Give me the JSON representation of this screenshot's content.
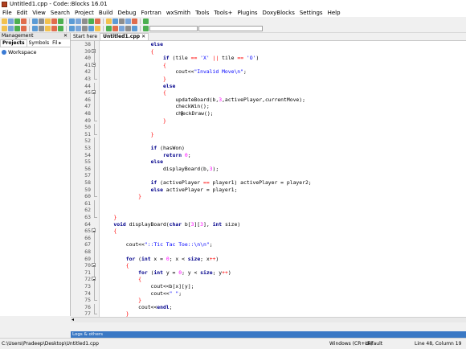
{
  "window": {
    "title": "Untitled1.cpp - Code::Blocks 16.01"
  },
  "menu": [
    "File",
    "Edit",
    "View",
    "Search",
    "Project",
    "Build",
    "Debug",
    "Fortran",
    "wxSmith",
    "Tools",
    "Tools+",
    "Plugins",
    "DoxyBlocks",
    "Settings",
    "Help"
  ],
  "management": {
    "title": "Management",
    "close": "✕",
    "tabs": [
      "Projects",
      "Symbols",
      "Fil ▸"
    ],
    "workspace": "Workspace"
  },
  "editor_tabs": {
    "start_here": "Start here",
    "file": "Untitled1.cpp",
    "file_close": "✕"
  },
  "code_lines": [
    {
      "n": "38",
      "fold": "bar",
      "t": [
        [
          "",
          "                "
        ],
        [
          "kw",
          "else"
        ]
      ]
    },
    {
      "n": "39",
      "fold": "box",
      "t": [
        [
          "",
          "                "
        ],
        [
          "br",
          "{"
        ]
      ]
    },
    {
      "n": "40",
      "fold": "bar",
      "t": [
        [
          "",
          "                    "
        ],
        [
          "kw",
          "if"
        ],
        [
          "",
          " (tile "
        ],
        [
          "op",
          "=="
        ],
        [
          "",
          " "
        ],
        [
          "str",
          "'X'"
        ],
        [
          "",
          " "
        ],
        [
          "op",
          "||"
        ],
        [
          "",
          " tile "
        ],
        [
          "op",
          "=="
        ],
        [
          "",
          " "
        ],
        [
          "str",
          "'O'"
        ],
        [
          "",
          ")"
        ]
      ]
    },
    {
      "n": "41",
      "fold": "box",
      "t": [
        [
          "",
          "                    "
        ],
        [
          "br",
          "{"
        ]
      ]
    },
    {
      "n": "42",
      "fold": "bar",
      "t": [
        [
          "",
          "                        cout<<"
        ],
        [
          "str",
          "\"Invalid Move\\n\""
        ],
        [
          "",
          ";"
        ]
      ]
    },
    {
      "n": "43",
      "fold": "corner",
      "t": [
        [
          "",
          "                    "
        ],
        [
          "br",
          "}"
        ]
      ]
    },
    {
      "n": "44",
      "fold": "bar",
      "t": [
        [
          "",
          "                    "
        ],
        [
          "kw",
          "else"
        ]
      ]
    },
    {
      "n": "45",
      "fold": "box",
      "t": [
        [
          "",
          "                    "
        ],
        [
          "br",
          "{"
        ]
      ]
    },
    {
      "n": "46",
      "fold": "bar",
      "t": [
        [
          "",
          "                        updateBoard(b,"
        ],
        [
          "num",
          "3"
        ],
        [
          "",
          ",activePlayer,currentMove);"
        ]
      ]
    },
    {
      "n": "47",
      "fold": "bar",
      "t": [
        [
          "",
          "                        checkWin();"
        ]
      ]
    },
    {
      "n": "48",
      "fold": "bar",
      "t": [
        [
          "",
          "                        ch"
        ],
        [
          "caret",
          ""
        ],
        [
          "",
          "eckDraw();"
        ]
      ]
    },
    {
      "n": "49",
      "fold": "corner",
      "t": [
        [
          "",
          "                    "
        ],
        [
          "br",
          "}"
        ]
      ]
    },
    {
      "n": "50",
      "fold": "bar",
      "t": [
        [
          "",
          ""
        ]
      ]
    },
    {
      "n": "51",
      "fold": "corner",
      "t": [
        [
          "",
          "                "
        ],
        [
          "br",
          "}"
        ]
      ]
    },
    {
      "n": "52",
      "fold": "bar",
      "t": [
        [
          "",
          ""
        ]
      ]
    },
    {
      "n": "53",
      "fold": "bar",
      "t": [
        [
          "",
          "                "
        ],
        [
          "kw",
          "if"
        ],
        [
          "",
          " (hasWon)"
        ]
      ]
    },
    {
      "n": "54",
      "fold": "bar",
      "t": [
        [
          "",
          "                    "
        ],
        [
          "kw",
          "return"
        ],
        [
          "",
          " "
        ],
        [
          "num",
          "0"
        ],
        [
          "",
          ";"
        ]
      ]
    },
    {
      "n": "55",
      "fold": "bar",
      "t": [
        [
          "",
          "                "
        ],
        [
          "kw",
          "else"
        ]
      ]
    },
    {
      "n": "56",
      "fold": "bar",
      "t": [
        [
          "",
          "                    displayBoard(b,"
        ],
        [
          "num",
          "3"
        ],
        [
          "",
          ");"
        ]
      ]
    },
    {
      "n": "57",
      "fold": "bar",
      "t": [
        [
          "",
          ""
        ]
      ]
    },
    {
      "n": "58",
      "fold": "bar",
      "t": [
        [
          "",
          "                "
        ],
        [
          "kw",
          "if"
        ],
        [
          "",
          " (activePlayer "
        ],
        [
          "op",
          "=="
        ],
        [
          "",
          " player1) activePlayer = player2;"
        ]
      ]
    },
    {
      "n": "59",
      "fold": "bar",
      "t": [
        [
          "",
          "                "
        ],
        [
          "kw",
          "else"
        ],
        [
          "",
          " activePlayer = player1;"
        ]
      ]
    },
    {
      "n": "60",
      "fold": "corner",
      "t": [
        [
          "",
          "            "
        ],
        [
          "br",
          "}"
        ]
      ]
    },
    {
      "n": "61",
      "fold": "bar",
      "t": [
        [
          "",
          ""
        ]
      ]
    },
    {
      "n": "62",
      "fold": "bar",
      "t": [
        [
          "",
          ""
        ]
      ]
    },
    {
      "n": "63",
      "fold": "corner",
      "t": [
        [
          "",
          "    "
        ],
        [
          "br",
          "}"
        ]
      ]
    },
    {
      "n": "64",
      "fold": "none",
      "t": [
        [
          "",
          "    "
        ],
        [
          "kw",
          "void"
        ],
        [
          "",
          " displayBoard("
        ],
        [
          "kw",
          "char"
        ],
        [
          "",
          " b["
        ],
        [
          "num",
          "3"
        ],
        [
          "",
          "]["
        ],
        [
          "num",
          "3"
        ],
        [
          "",
          "], "
        ],
        [
          "kw",
          "int"
        ],
        [
          "",
          " size)"
        ]
      ]
    },
    {
      "n": "65",
      "fold": "box",
      "t": [
        [
          "",
          "    "
        ],
        [
          "br",
          "{"
        ]
      ]
    },
    {
      "n": "66",
      "fold": "bar",
      "t": [
        [
          "",
          ""
        ]
      ]
    },
    {
      "n": "67",
      "fold": "bar",
      "t": [
        [
          "",
          "        cout<<"
        ],
        [
          "str",
          "\"::Tic Tac Toe::\\n\\n\""
        ],
        [
          "",
          ";"
        ]
      ]
    },
    {
      "n": "68",
      "fold": "bar",
      "t": [
        [
          "",
          ""
        ]
      ]
    },
    {
      "n": "69",
      "fold": "bar",
      "t": [
        [
          "",
          "        "
        ],
        [
          "kw",
          "for"
        ],
        [
          "",
          " ("
        ],
        [
          "kw",
          "int"
        ],
        [
          "",
          " x = "
        ],
        [
          "num",
          "0"
        ],
        [
          "",
          "; x < "
        ],
        [
          "kw",
          "size"
        ],
        [
          "",
          "; x"
        ],
        [
          "op",
          "++"
        ],
        [
          "",
          ")"
        ]
      ]
    },
    {
      "n": "70",
      "fold": "box",
      "t": [
        [
          "",
          "        "
        ],
        [
          "br",
          "{"
        ]
      ]
    },
    {
      "n": "71",
      "fold": "bar",
      "t": [
        [
          "",
          "            "
        ],
        [
          "kw",
          "for"
        ],
        [
          "",
          " ("
        ],
        [
          "kw",
          "int"
        ],
        [
          "",
          " y = "
        ],
        [
          "num",
          "0"
        ],
        [
          "",
          "; y < "
        ],
        [
          "kw",
          "size"
        ],
        [
          "",
          "; y"
        ],
        [
          "op",
          "++"
        ],
        [
          "",
          ")"
        ]
      ]
    },
    {
      "n": "72",
      "fold": "box",
      "t": [
        [
          "",
          "            "
        ],
        [
          "br",
          "{"
        ]
      ]
    },
    {
      "n": "73",
      "fold": "bar",
      "t": [
        [
          "",
          "                cout<<b[x][y];"
        ]
      ]
    },
    {
      "n": "74",
      "fold": "bar",
      "t": [
        [
          "",
          "                cout<<"
        ],
        [
          "str",
          "\" \""
        ],
        [
          "",
          ";"
        ]
      ]
    },
    {
      "n": "75",
      "fold": "corner",
      "t": [
        [
          "",
          "            "
        ],
        [
          "br",
          "}"
        ]
      ]
    },
    {
      "n": "76",
      "fold": "bar",
      "t": [
        [
          "",
          "            cout<<"
        ],
        [
          "kw",
          "endl"
        ],
        [
          "",
          ";"
        ]
      ]
    },
    {
      "n": "77",
      "fold": "corner",
      "t": [
        [
          "",
          "        "
        ],
        [
          "br",
          "}"
        ]
      ]
    },
    {
      "n": "78",
      "fold": "bar",
      "t": [
        [
          "",
          "        cout<<"
        ],
        [
          "kw",
          "endl"
        ],
        [
          "",
          ";"
        ]
      ]
    }
  ],
  "logs": {
    "label": "Logs & others"
  },
  "status": {
    "path": "C:\\Users\\Pradeep\\Desktop\\Untitled1.cpp",
    "eol": "Windows (CR+LF)",
    "encoding": "default",
    "position": "Line 48, Column 19"
  },
  "hscroll_arrow": "◂"
}
